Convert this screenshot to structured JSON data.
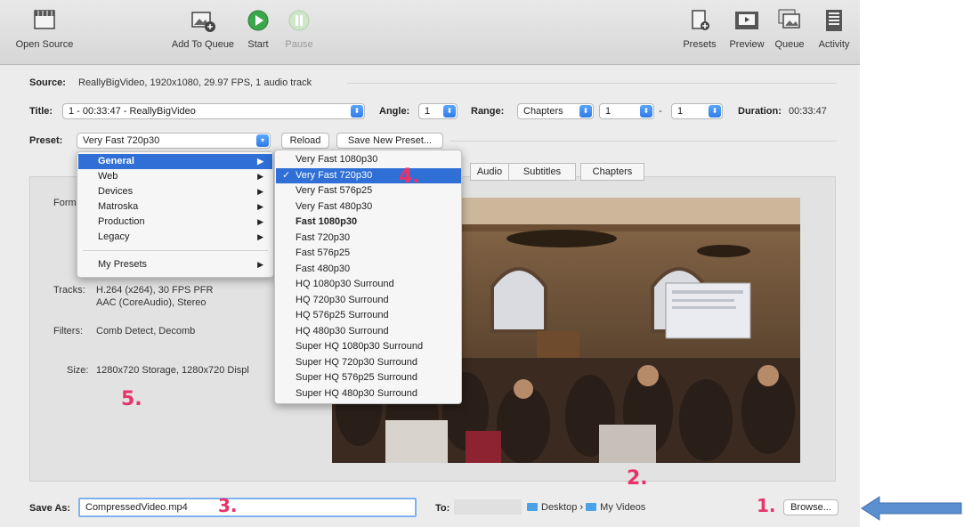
{
  "toolbar": {
    "open_source": "Open Source",
    "add_to_queue": "Add To Queue",
    "start": "Start",
    "pause": "Pause",
    "presets": "Presets",
    "preview": "Preview",
    "queue": "Queue",
    "activity": "Activity"
  },
  "source": {
    "label": "Source:",
    "value": "ReallyBigVideo, 1920x1080, 29.97 FPS, 1 audio track"
  },
  "title_row": {
    "title_label": "Title:",
    "title_value": "1 - 00:33:47 - ReallyBigVideo",
    "angle_label": "Angle:",
    "angle_value": "1",
    "range_label": "Range:",
    "range_type": "Chapters",
    "range_start": "1",
    "range_dash": "-",
    "range_end": "1",
    "duration_label": "Duration:",
    "duration_value": "00:33:47"
  },
  "preset_row": {
    "label": "Preset:",
    "value": "Very Fast 720p30",
    "reload": "Reload",
    "save_new": "Save New Preset..."
  },
  "tabs": [
    "Audio",
    "Subtitles",
    "Chapters"
  ],
  "summary": {
    "format_label": "Form",
    "tracks_label": "Tracks:",
    "tracks_line1": "H.264 (x264), 30 FPS PFR",
    "tracks_line2": "AAC (CoreAudio), Stereo",
    "filters_label": "Filters:",
    "filters_value": "Comb Detect, Decomb",
    "size_label": "Size:",
    "size_value": "1280x720 Storage, 1280x720 Displ"
  },
  "category_menu": {
    "items": [
      "General",
      "Web",
      "Devices",
      "Matroska",
      "Production",
      "Legacy"
    ],
    "my_presets": "My Presets",
    "selected": "General"
  },
  "preset_menu": {
    "items": [
      "Very Fast 1080p30",
      "Very Fast 720p30",
      "Very Fast 576p25",
      "Very Fast 480p30",
      "Fast 1080p30",
      "Fast 720p30",
      "Fast 576p25",
      "Fast 480p30",
      "HQ 1080p30 Surround",
      "HQ 720p30 Surround",
      "HQ 576p25 Surround",
      "HQ 480p30 Surround",
      "Super HQ 1080p30 Surround",
      "Super HQ 720p30 Surround",
      "Super HQ 576p25 Surround",
      "Super HQ 480p30 Surround"
    ],
    "checked": "Very Fast 720p30",
    "bold": "Fast 1080p30",
    "check_glyph": "✓"
  },
  "save_row": {
    "label": "Save As:",
    "filename": "CompressedVideo.mp4",
    "to_label": "To:",
    "path_1": "Desktop",
    "path_sep": "›",
    "path_2": "My Videos",
    "browse": "Browse..."
  },
  "annotations": {
    "n1": "1.",
    "n2": "2.",
    "n3": "3.",
    "n4": "4.",
    "n5": "5."
  },
  "colors": {
    "accent": "#2f6fd6",
    "annotation": "#e8336a",
    "arrow": "#5b8fd0",
    "folder": "#4aa3e8",
    "start_button": "#2e9f3e"
  }
}
